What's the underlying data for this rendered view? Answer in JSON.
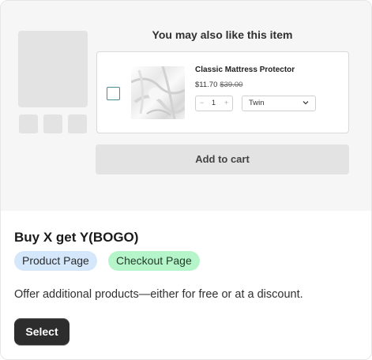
{
  "preview": {
    "heading": "You may also like this item",
    "product": {
      "title": "Classic Mattress Protector",
      "price": "$11.70",
      "compare_price": "$39.00",
      "quantity": "1",
      "quantity_minus": "−",
      "quantity_plus": "+",
      "variant": "Twin"
    },
    "add_to_cart_label": "Add to cart"
  },
  "offer": {
    "title": "Buy X get Y(BOGO)",
    "badges": [
      "Product Page",
      "Checkout Page"
    ],
    "description": "Offer additional products—either for free or at a discount.",
    "select_label": "Select"
  },
  "colors": {
    "product_badge_bg": "#d4e7fb",
    "checkout_badge_bg": "#b6f5c9",
    "select_button_bg": "#2d2d2d",
    "preview_bg": "#f6f6f6"
  }
}
